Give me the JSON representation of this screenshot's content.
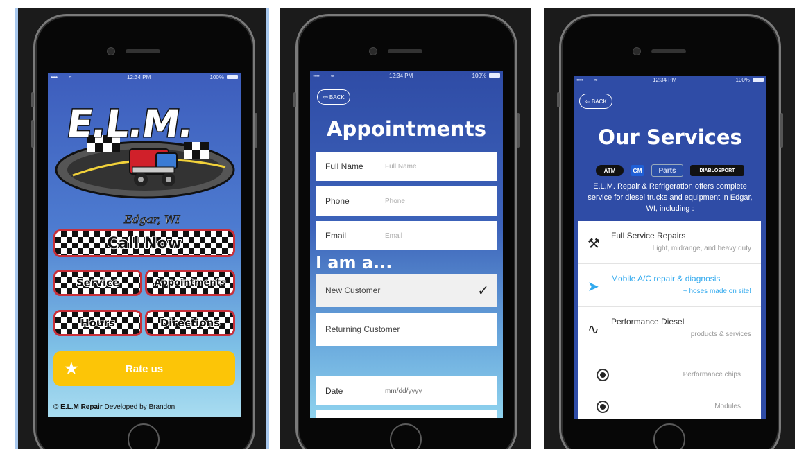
{
  "status": {
    "signal": "•••••",
    "wifi": "≈",
    "time": "12:34 PM",
    "battery": "100%"
  },
  "screen1": {
    "logo_text": "E.L.M.",
    "logo_script": "Edgar, WI",
    "call_now": "Call Now",
    "service": "Service",
    "appointments": "Appointments",
    "hours": "Hours",
    "directions": "Directions",
    "rate_us": "Rate us",
    "footer_copy": "© E.L.M Repair",
    "footer_dev": "Developed by",
    "footer_author": "Brandon"
  },
  "screen2": {
    "back": "BACK",
    "title": "Appointments",
    "fields": [
      {
        "label": "Full Name",
        "placeholder": "Full Name"
      },
      {
        "label": "Phone",
        "placeholder": "Phone"
      },
      {
        "label": "Email",
        "placeholder": "Email"
      }
    ],
    "iam": "I am a...",
    "options": [
      "New Customer",
      "Returning Customer"
    ],
    "date": {
      "label": "Date",
      "placeholder": "mm/dd/yyyy"
    }
  },
  "screen3": {
    "back": "BACK",
    "title": "Our Services",
    "brands": [
      "ATM",
      "GM",
      "Parts",
      "DIABLOSPORT"
    ],
    "description": "E.L.M. Repair & Refrigeration offers complete service for diesel trucks and equipment in Edgar, WI, including :",
    "services": [
      {
        "title": "Full Service Repairs",
        "subtitle": "Light, midrange, and heavy duty",
        "icon": "tools-icon"
      },
      {
        "title": "Mobile A/C repair & diagnosis",
        "subtitle": "~ hoses made on site!",
        "icon": "paper-plane-icon"
      },
      {
        "title": "Performance Diesel",
        "subtitle": "products & services",
        "icon": "pulse-icon"
      }
    ],
    "sub_options": [
      "Performance chips",
      "Modules"
    ]
  },
  "colors": {
    "accent_yellow": "#fcc507",
    "blue": "#2f4ca6",
    "highlight": "#33aaee",
    "checker_border": "#c8303a"
  }
}
